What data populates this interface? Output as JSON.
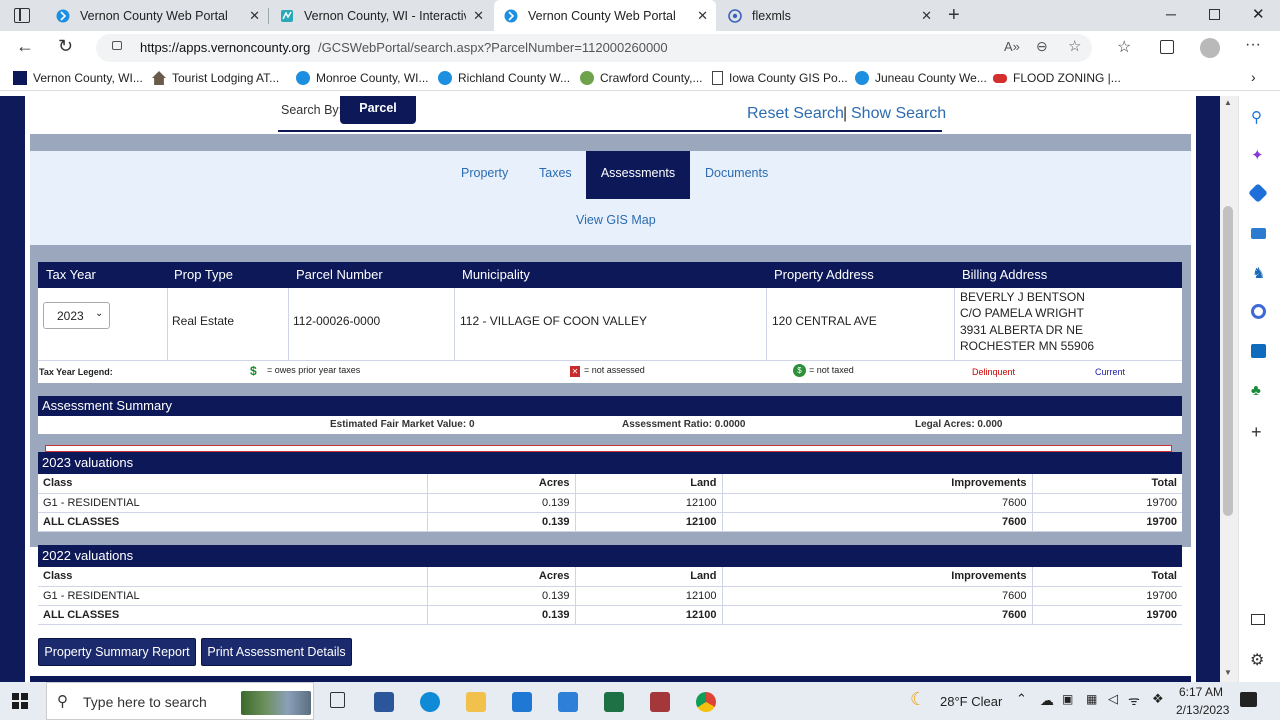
{
  "browser": {
    "tabs": [
      {
        "title": "Vernon County Web Portal",
        "active": false
      },
      {
        "title": "Vernon County, WI - Interactive Ma",
        "active": false
      },
      {
        "title": "Vernon County Web Portal",
        "active": true
      },
      {
        "title": "flexmls",
        "active": false
      }
    ],
    "url": "https://apps.vernoncounty.org/GCSWebPortal/search.aspx?ParcelNumber=112000260000",
    "url_host": "https://apps.vernoncounty.org",
    "url_path": "/GCSWebPortal/search.aspx?ParcelNumber=112000260000",
    "bookmarks": [
      "Vernon County, WI...",
      "Tourist Lodging AT...",
      "Monroe County, WI...",
      "Richland County W...",
      "Crawford County,...",
      "Iowa County GIS Po...",
      "Juneau County We...",
      "FLOOD ZONING |..."
    ]
  },
  "search": {
    "search_by_label": "Search By:",
    "search_by_value": "Parcel",
    "reset": "Reset Search",
    "separator": "|",
    "show": "Show Search"
  },
  "nav": {
    "tabs": [
      "Property",
      "Taxes",
      "Assessments",
      "Documents"
    ],
    "active_tab": "Assessments",
    "gis_link": "View GIS Map"
  },
  "parcel": {
    "headers": [
      "Tax Year",
      "Prop Type",
      "Parcel Number",
      "Municipality",
      "Property Address",
      "Billing Address"
    ],
    "tax_year": "2023",
    "prop_type": "Real Estate",
    "parcel_number": "112-00026-0000",
    "municipality": "112 - VILLAGE OF COON VALLEY",
    "property_address": "120 CENTRAL AVE",
    "billing_address": [
      "BEVERLY J BENTSON",
      "C/O PAMELA WRIGHT",
      "3931 ALBERTA DR NE",
      "ROCHESTER MN 55906"
    ]
  },
  "legend": {
    "label": "Tax Year Legend:",
    "owes": "= owes prior year taxes",
    "not_assessed": "= not assessed",
    "not_taxed": "= not taxed",
    "delinquent": "Delinquent",
    "current": "Current"
  },
  "summary": {
    "title": "Assessment Summary",
    "fair_market": "Estimated Fair Market Value: 0",
    "ratio": "Assessment Ratio: 0.0000",
    "legal_acres": "Legal Acres: 0.000"
  },
  "valuations": [
    {
      "title": "2023 valuations",
      "columns": [
        "Class",
        "Acres",
        "Land",
        "Improvements",
        "Total"
      ],
      "rows": [
        {
          "class": "G1 - RESIDENTIAL",
          "acres": "0.139",
          "land": "12100",
          "improvements": "7600",
          "total": "19700",
          "bold": false
        },
        {
          "class": "ALL CLASSES",
          "acres": "0.139",
          "land": "12100",
          "improvements": "7600",
          "total": "19700",
          "bold": true
        }
      ]
    },
    {
      "title": "2022 valuations",
      "columns": [
        "Class",
        "Acres",
        "Land",
        "Improvements",
        "Total"
      ],
      "rows": [
        {
          "class": "G1 - RESIDENTIAL",
          "acres": "0.139",
          "land": "12100",
          "improvements": "7600",
          "total": "19700",
          "bold": false
        },
        {
          "class": "ALL CLASSES",
          "acres": "0.139",
          "land": "12100",
          "improvements": "7600",
          "total": "19700",
          "bold": true
        }
      ]
    }
  ],
  "buttons": {
    "summary_report": "Property Summary Report",
    "print_details": "Print Assessment Details"
  },
  "taskbar": {
    "search_placeholder": "Type here to search",
    "weather": "28°F  Clear",
    "time": "6:17 AM",
    "date": "2/13/2023"
  },
  "colors": {
    "navy": "#0d1859",
    "link": "#2b6cb0",
    "band": "#e8f0fb",
    "delinquent": "#cc0000",
    "current": "#1a1aa6"
  }
}
